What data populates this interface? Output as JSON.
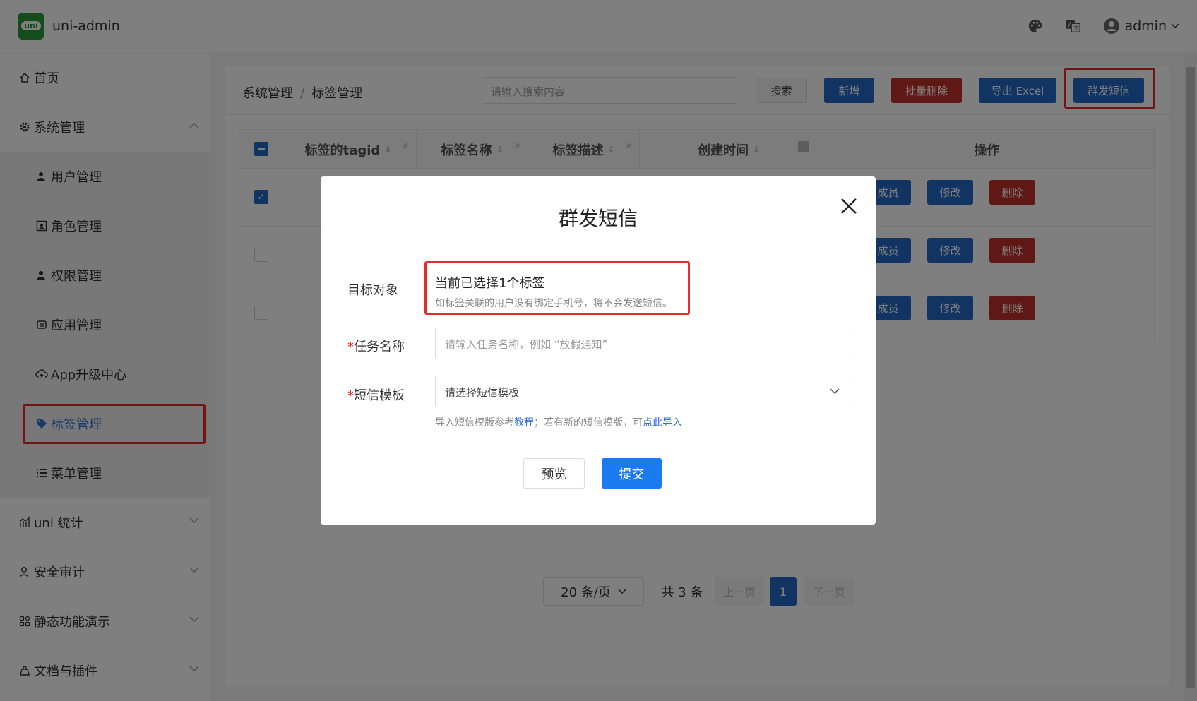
{
  "app": {
    "logo_text": "uni",
    "title": "uni-admin",
    "username": "admin"
  },
  "sidebar": {
    "home": "首页",
    "system": "系统管理",
    "sub": [
      "用户管理",
      "角色管理",
      "权限管理",
      "应用管理",
      "App升级中心",
      "标签管理",
      "菜单管理"
    ],
    "groups": [
      "uni 统计",
      "安全审计",
      "静态功能演示",
      "文档与插件"
    ]
  },
  "breadcrumb": {
    "parent": "系统管理",
    "separator": "/",
    "current": "标签管理"
  },
  "toolbar": {
    "search_placeholder": "请输入搜索内容",
    "search": "搜索",
    "add": "新增",
    "batch_delete": "批量删除",
    "export": "导出 Excel",
    "sms": "群发短信"
  },
  "table": {
    "headers": [
      "标签的tagid",
      "标签名称",
      "标签描述",
      "创建时间",
      "操作"
    ],
    "row_actions": {
      "members": "成员",
      "edit": "修改",
      "delete": "删除"
    },
    "rows_checked": [
      true,
      false,
      false
    ]
  },
  "pagination": {
    "page_size": "20 条/页",
    "total": "共 3 条",
    "prev": "上一页",
    "page": "1",
    "next": "下一页"
  },
  "dialog": {
    "title": "群发短信",
    "target_label": "目标对象",
    "target_value": "当前已选择1个标签",
    "target_hint": "如标签关联的用户没有绑定手机号，将不会发送短信。",
    "task_label": "任务名称",
    "task_placeholder": "请输入任务名称，例如 “放假通知”",
    "template_label": "短信模板",
    "template_placeholder": "请选择短信模板",
    "template_hint_1": "导入短信模版参考",
    "template_hint_link1": "教程",
    "template_hint_2": "；若有新的短信模版，可",
    "template_hint_link2": "点此导入",
    "preview": "预览",
    "submit": "提交",
    "required_mark": "*"
  },
  "colors": {
    "primary": "#2569c6",
    "danger": "#c0302a",
    "highlight": "#e52b2b",
    "dialog_primary": "#1a7af0"
  }
}
